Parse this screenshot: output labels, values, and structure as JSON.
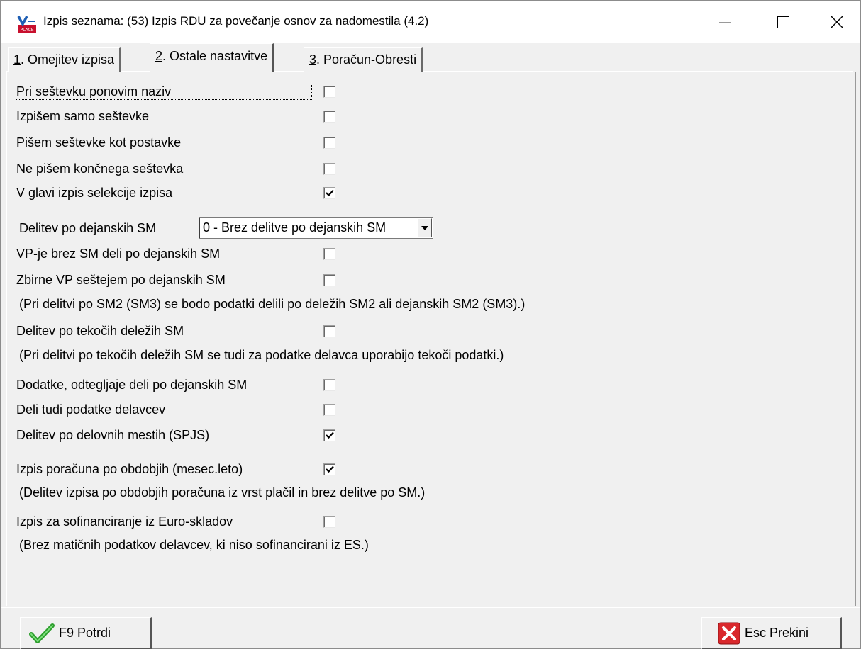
{
  "window": {
    "title": "Izpis seznama: (53)  Izpis RDU za povečanje osnov za nadomestila  (4.2)"
  },
  "tabs": [
    {
      "key": "1",
      "label": ". Omejitev izpisa",
      "active": false
    },
    {
      "key": "2",
      "label": ". Ostale nastavitve",
      "active": true
    },
    {
      "key": "3",
      "label": ". Poračun-Obresti",
      "active": false
    }
  ],
  "options": {
    "repeat_name": {
      "label": "Pri seštevku ponovim naziv",
      "checked": false
    },
    "only_sums": {
      "label": "Izpišem samo seštevke",
      "checked": false
    },
    "sums_as_items": {
      "label": "Pišem seštevke kot postavke",
      "checked": false
    },
    "no_final_sum": {
      "label": "Ne pišem končnega seštevka",
      "checked": false
    },
    "header_selection": {
      "label": "V glavi izpis selekcije izpisa",
      "checked": true
    },
    "split_by_sm": {
      "label": "Delitev po dejanskih SM",
      "value": "0 - Brez delitve po dejanskih SM"
    },
    "vp_no_sm": {
      "label": "VP-je brez SM deli po dejanskih SM",
      "checked": false
    },
    "sum_vp_by_sm": {
      "label": "Zbirne VP seštejem po dejanskih SM",
      "checked": false
    },
    "note_sm2": "(Pri delitvi po SM2 (SM3) se bodo podatki delili po deležih SM2 ali dejanskih SM2 (SM3).)",
    "current_shares": {
      "label": "Delitev po tekočih deležih SM",
      "checked": false
    },
    "note_current": "(Pri delitvi po tekočih deležih SM se tudi za podatke delavca uporabijo tekoči podatki.)",
    "extras_by_sm": {
      "label": "Dodatke, odtegljaje deli po dejanskih SM",
      "checked": false
    },
    "split_worker_data": {
      "label": "Deli tudi podatke delavcev",
      "checked": false
    },
    "split_by_workplace": {
      "label": "Delitev po delovnih mestih (SPJS)",
      "checked": true
    },
    "by_period": {
      "label": "Izpis poračuna po obdobjih (mesec.leto)",
      "checked": true
    },
    "note_period": "(Delitev izpisa po obdobjih poračuna iz vrst plačil in brez delitve po SM.)",
    "euro_funds": {
      "label": "Izpis za sofinanciranje iz Euro-skladov",
      "checked": false
    },
    "note_euro": "(Brez matičnih podatkov delavcev, ki niso sofinancirani iz ES.)"
  },
  "buttons": {
    "confirm": "F9 Potrdi",
    "cancel": "Esc Prekini"
  }
}
